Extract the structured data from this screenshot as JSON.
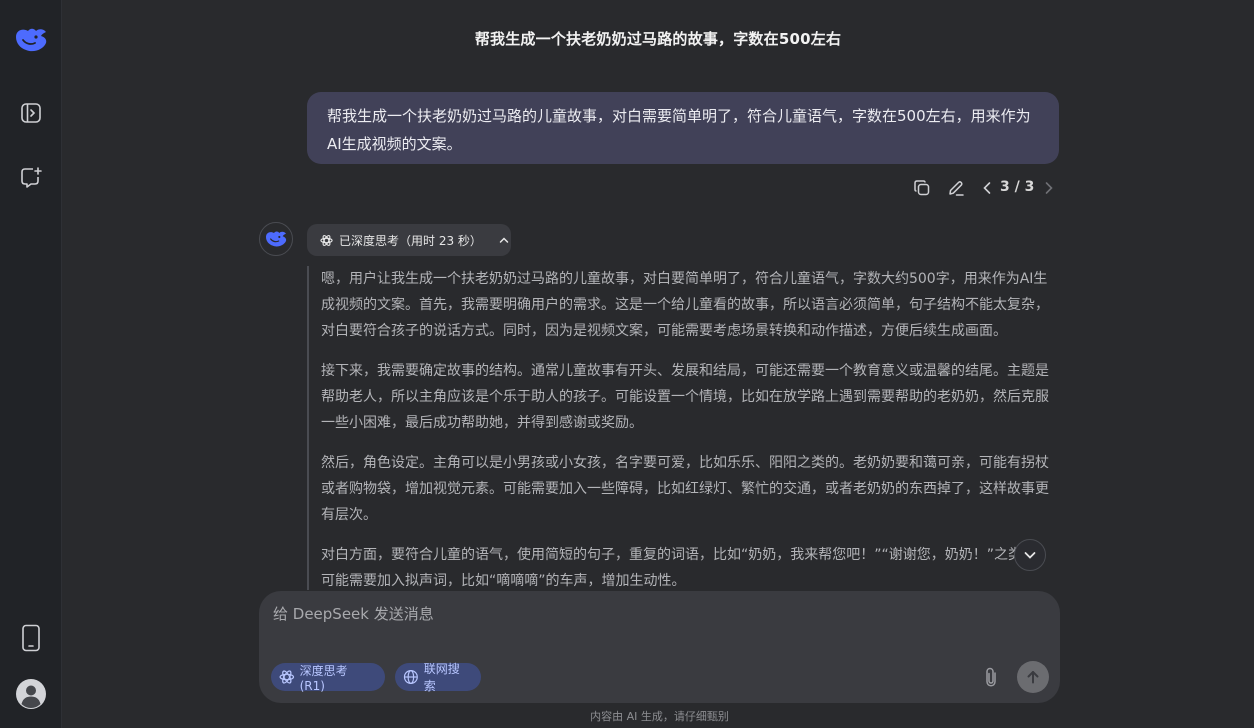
{
  "header": {
    "title": "帮我生成一个扶老奶奶过马路的故事，字数在500左右"
  },
  "user_message": {
    "text": "帮我生成一个扶老奶奶过马路的儿童故事，对白需要简单明了，符合儿童语气，字数在500左右，用来作为AI生成视频的文案。",
    "pager": "3 / 3"
  },
  "assistant": {
    "think_label": "已深度思考（用时 23 秒）",
    "reasoning": [
      "嗯，用户让我生成一个扶老奶奶过马路的儿童故事，对白要简单明了，符合儿童语气，字数大约500字，用来作为AI生成视频的文案。首先，我需要明确用户的需求。这是一个给儿童看的故事，所以语言必须简单，句子结构不能太复杂，对白要符合孩子的说话方式。同时，因为是视频文案，可能需要考虑场景转换和动作描述，方便后续生成画面。",
      "接下来，我需要确定故事的结构。通常儿童故事有开头、发展和结局，可能还需要一个教育意义或温馨的结尾。主题是帮助老人，所以主角应该是个乐于助人的孩子。可能设置一个情境，比如在放学路上遇到需要帮助的老奶奶，然后克服一些小困难，最后成功帮助她，并得到感谢或奖励。",
      "然后，角色设定。主角可以是小男孩或小女孩，名字要可爱，比如乐乐、阳阳之类的。老奶奶要和蔼可亲，可能有拐杖或者购物袋，增加视觉元素。可能需要加入一些障碍，比如红绿灯、繁忙的交通，或者老奶奶的东西掉了，这样故事更有层次。",
      "对白方面，要符合儿童的语气，使用简短的句子，重复的词语，比如“奶奶，我来帮您吧！”“谢谢您，奶奶！”之类的。可能需要加入拟声词，比如“嘀嘀嘀”的车声，增加生动性。"
    ]
  },
  "composer": {
    "placeholder": "给 DeepSeek 发送消息",
    "chip_think": "深度思考 (R1)",
    "chip_search": "联网搜索"
  },
  "footer": {
    "disclaimer": "内容由 AI 生成，请仔细甄别"
  },
  "colors": {
    "brand": "#4d6bfe",
    "bubble": "#414158",
    "chip_bg": "#3e4a7a",
    "chip_text": "#b8c6ff"
  }
}
